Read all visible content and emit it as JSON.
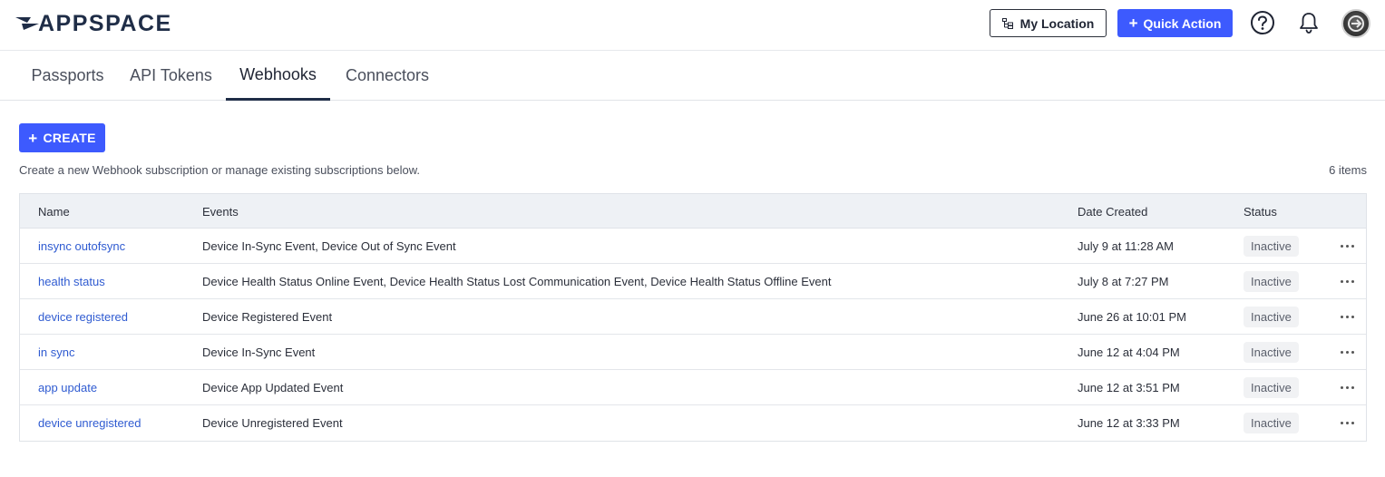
{
  "header": {
    "logo_text": "APPSPACE",
    "my_location_label": "My Location",
    "quick_action_label": "Quick Action",
    "icons": [
      "location-tree-icon",
      "plus-icon",
      "help-circle-icon",
      "bell-icon",
      "avatar"
    ]
  },
  "tabs": [
    {
      "label": "Passports",
      "active": false
    },
    {
      "label": "API Tokens",
      "active": false
    },
    {
      "label": "Webhooks",
      "active": true
    },
    {
      "label": "Connectors",
      "active": false
    }
  ],
  "main": {
    "create_label": "CREATE",
    "description": "Create a new Webhook subscription or manage existing subscriptions below.",
    "item_count": "6 items"
  },
  "table": {
    "columns": [
      "Name",
      "Events",
      "Date Created",
      "Status"
    ],
    "rows": [
      {
        "name": "insync outofsync",
        "events": "Device In-Sync Event, Device Out of Sync Event",
        "date": "July 9 at 11:28 AM",
        "status": "Inactive"
      },
      {
        "name": "health status",
        "events": "Device Health Status Online Event, Device Health Status Lost Communication Event, Device Health Status Offline Event",
        "date": "July 8 at 7:27 PM",
        "status": "Inactive"
      },
      {
        "name": "device registered",
        "events": "Device Registered Event",
        "date": "June 26 at 10:01 PM",
        "status": "Inactive"
      },
      {
        "name": "in sync",
        "events": "Device In-Sync Event",
        "date": "June 12 at 4:04 PM",
        "status": "Inactive"
      },
      {
        "name": "app update",
        "events": "Device App Updated Event",
        "date": "June 12 at 3:51 PM",
        "status": "Inactive"
      },
      {
        "name": "device unregistered",
        "events": "Device Unregistered Event",
        "date": "June 12 at 3:33 PM",
        "status": "Inactive"
      }
    ]
  },
  "colors": {
    "accent": "#3d5afe",
    "link": "#2f5bd1",
    "brand_dark": "#1f2d47",
    "table_header_bg": "#eef1f5"
  }
}
